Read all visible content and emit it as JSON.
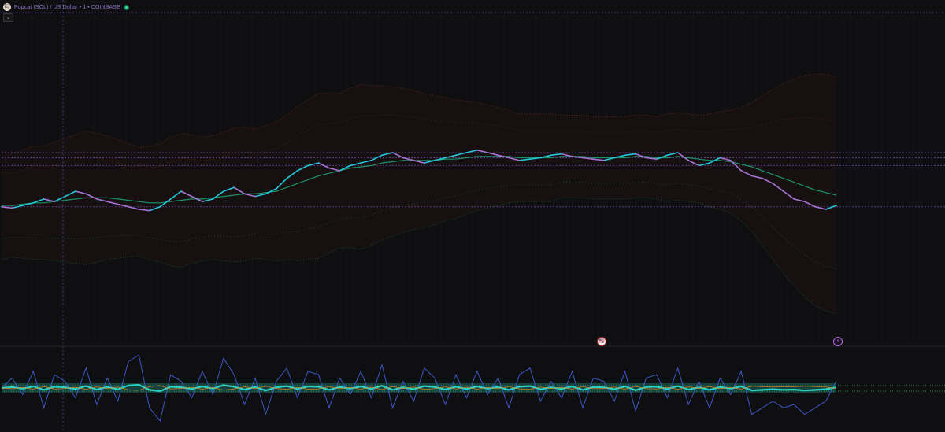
{
  "header": {
    "logo_glyph": "🐱",
    "title": "Popcat (SOL) / US Dollar • 1 • COINBASE",
    "status": "live-dot-icon",
    "collapse_glyph": "⌄"
  },
  "events": {
    "flag_glyph": "🇺🇸",
    "bolt_glyph": "⚡"
  },
  "colors": {
    "background": "#0f0f11",
    "price_up": "#26c6da",
    "price_down": "#a774d6",
    "ma_line": "#1e8f6a",
    "upper_band": "#7a2e1e",
    "lower_band": "#1f5e3a",
    "band_fill": "#1a1210",
    "oscillator": "#3b57c4",
    "osc_band": "#2ad2c4",
    "level_line": "#7b4fb6",
    "accent": "#b86ee8"
  },
  "chart_data": {
    "type": "line",
    "title": "Popcat (SOL) / US Dollar • 1 • COINBASE",
    "xlabel": "",
    "ylabel": "",
    "grid": true,
    "legend": "none",
    "price_series": {
      "name": "",
      "values": [
        0.3,
        0.29,
        0.31,
        0.33,
        0.36,
        0.34,
        0.38,
        0.42,
        0.4,
        0.36,
        0.34,
        0.32,
        0.3,
        0.28,
        0.27,
        0.3,
        0.36,
        0.42,
        0.38,
        0.34,
        0.36,
        0.42,
        0.45,
        0.4,
        0.38,
        0.4,
        0.44,
        0.52,
        0.58,
        0.62,
        0.64,
        0.6,
        0.58,
        0.62,
        0.64,
        0.66,
        0.7,
        0.72,
        0.68,
        0.66,
        0.64,
        0.66,
        0.68,
        0.7,
        0.72,
        0.74,
        0.72,
        0.7,
        0.68,
        0.66,
        0.67,
        0.68,
        0.7,
        0.71,
        0.69,
        0.68,
        0.67,
        0.66,
        0.68,
        0.7,
        0.71,
        0.68,
        0.67,
        0.7,
        0.72,
        0.66,
        0.62,
        0.64,
        0.68,
        0.66,
        0.58,
        0.54,
        0.52,
        0.48,
        0.42,
        0.36,
        0.34,
        0.3,
        0.28,
        0.31
      ]
    },
    "ma_series": {
      "name": "",
      "values": [
        0.31,
        0.31,
        0.32,
        0.33,
        0.33,
        0.34,
        0.35,
        0.36,
        0.37,
        0.37,
        0.37,
        0.36,
        0.35,
        0.34,
        0.33,
        0.33,
        0.34,
        0.35,
        0.36,
        0.36,
        0.37,
        0.38,
        0.39,
        0.4,
        0.4,
        0.41,
        0.42,
        0.45,
        0.48,
        0.51,
        0.54,
        0.56,
        0.58,
        0.6,
        0.61,
        0.62,
        0.64,
        0.65,
        0.66,
        0.66,
        0.66,
        0.66,
        0.67,
        0.67,
        0.68,
        0.69,
        0.69,
        0.69,
        0.69,
        0.68,
        0.68,
        0.68,
        0.68,
        0.69,
        0.69,
        0.69,
        0.68,
        0.68,
        0.68,
        0.68,
        0.69,
        0.69,
        0.68,
        0.68,
        0.69,
        0.68,
        0.67,
        0.66,
        0.66,
        0.65,
        0.63,
        0.61,
        0.58,
        0.55,
        0.52,
        0.49,
        0.46,
        0.43,
        0.41,
        0.39
      ]
    },
    "band_width": [
      0.42,
      0.4,
      0.42,
      0.44,
      0.44,
      0.46,
      0.48,
      0.5,
      0.52,
      0.5,
      0.48,
      0.46,
      0.44,
      0.42,
      0.44,
      0.46,
      0.5,
      0.52,
      0.5,
      0.48,
      0.48,
      0.5,
      0.52,
      0.52,
      0.5,
      0.52,
      0.54,
      0.56,
      0.6,
      0.62,
      0.64,
      0.62,
      0.6,
      0.62,
      0.64,
      0.62,
      0.6,
      0.58,
      0.56,
      0.54,
      0.52,
      0.5,
      0.48,
      0.46,
      0.44,
      0.42,
      0.4,
      0.38,
      0.36,
      0.34,
      0.34,
      0.34,
      0.34,
      0.32,
      0.32,
      0.32,
      0.32,
      0.32,
      0.32,
      0.32,
      0.32,
      0.32,
      0.32,
      0.34,
      0.34,
      0.34,
      0.34,
      0.36,
      0.38,
      0.4,
      0.44,
      0.5,
      0.58,
      0.66,
      0.74,
      0.8,
      0.86,
      0.9,
      0.92,
      0.92
    ],
    "oscillator_series": {
      "name": "",
      "values": [
        0.0,
        0.3,
        -0.2,
        0.5,
        -0.6,
        0.4,
        0.2,
        -0.3,
        0.6,
        -0.5,
        0.3,
        -0.4,
        0.8,
        1.0,
        -0.6,
        -1.0,
        0.4,
        0.2,
        -0.3,
        0.5,
        -0.2,
        0.9,
        0.4,
        -0.5,
        0.3,
        -0.8,
        0.2,
        0.6,
        -0.3,
        0.5,
        0.4,
        -0.6,
        0.3,
        -0.2,
        0.5,
        -0.3,
        0.7,
        -0.6,
        0.2,
        -0.4,
        0.6,
        0.3,
        -0.5,
        0.4,
        -0.3,
        0.5,
        -0.2,
        0.3,
        -0.6,
        0.4,
        0.6,
        -0.4,
        0.2,
        -0.3,
        0.5,
        -0.6,
        0.3,
        0.2,
        -0.4,
        0.5,
        -0.7,
        0.3,
        0.4,
        -0.3,
        0.6,
        -0.5,
        0.2,
        -0.6,
        0.3,
        -0.2,
        0.5,
        -0.8,
        -0.6,
        -0.4,
        -0.6,
        -0.5,
        -0.8,
        -0.6,
        -0.4,
        0.2
      ]
    },
    "levels": [
      0.3,
      0.62,
      0.68,
      0.72
    ]
  }
}
